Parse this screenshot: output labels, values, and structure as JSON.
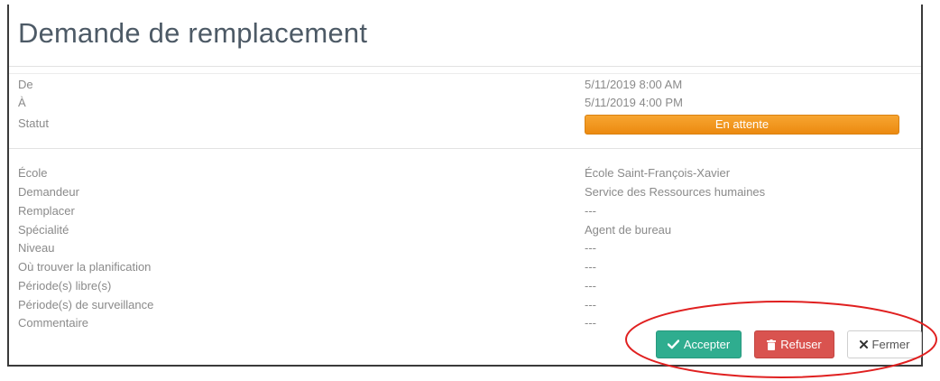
{
  "modal": {
    "title": "Demande de remplacement"
  },
  "fields_top": [
    {
      "label": "De",
      "value": "5/11/2019 8:00 AM"
    },
    {
      "label": "À",
      "value": "5/11/2019 4:00 PM"
    },
    {
      "label": "Statut",
      "value": "En attente"
    }
  ],
  "fields_details": [
    {
      "label": "École",
      "value": "École Saint-François-Xavier"
    },
    {
      "label": "Demandeur",
      "value": "Service des Ressources humaines"
    },
    {
      "label": "Remplacer",
      "value": "---"
    },
    {
      "label": "Spécialité",
      "value": "Agent de bureau"
    },
    {
      "label": "Niveau",
      "value": "---"
    },
    {
      "label": "Où trouver la planification",
      "value": "---"
    },
    {
      "label": "Période(s) libre(s)",
      "value": "---"
    },
    {
      "label": "Période(s) de surveillance",
      "value": "---"
    },
    {
      "label": "Commentaire",
      "value": "---"
    }
  ],
  "actions": {
    "accept_label": "Accepter",
    "refuse_label": "Refuser",
    "close_label": "Fermer"
  },
  "icons": {
    "accept": "check-icon",
    "refuse": "trash-icon",
    "close": "times-icon"
  },
  "colors": {
    "status_badge": "#ec8a10",
    "accept": "#2fad8f",
    "refuse": "#d9534f",
    "annotation": "#e02020"
  }
}
